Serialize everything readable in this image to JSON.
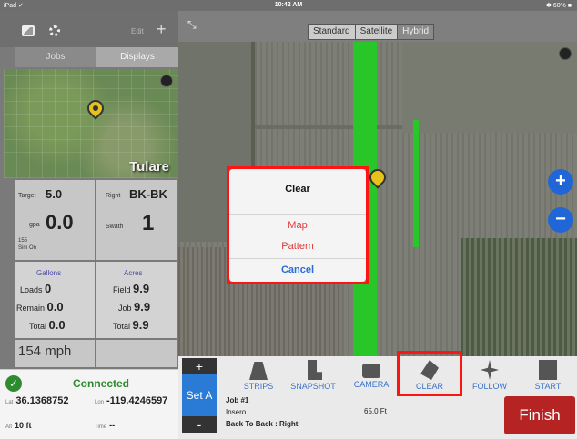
{
  "status_bar": {
    "left": "iPad ✓",
    "time": "10:42 AM",
    "right": "✱ 60% ■"
  },
  "left_panel": {
    "edit_label": "Edit",
    "add_label": "+",
    "tabs": [
      {
        "label": "Jobs",
        "selected": false
      },
      {
        "label": "Displays",
        "selected": true
      }
    ],
    "minimap_label": "Tulare",
    "tiles": {
      "target": {
        "label": "Target",
        "value": "5.0",
        "unit": "gpa",
        "big": "0.0",
        "sub1": "155",
        "sub2": "Sim On"
      },
      "right": {
        "label": "Right",
        "value": "BK-BK",
        "swath_label": "Swath",
        "swath_value": "1"
      },
      "gallons": {
        "title": "Gallons",
        "rows": [
          {
            "k": "Loads",
            "v": "0"
          },
          {
            "k": "Remain",
            "v": "0.0"
          },
          {
            "k": "Total",
            "v": "0.0"
          }
        ]
      },
      "acres": {
        "title": "Acres",
        "rows": [
          {
            "k": "Field",
            "v": "9.9"
          },
          {
            "k": "Job",
            "v": "9.9"
          },
          {
            "k": "Total",
            "v": "9.9"
          }
        ]
      },
      "speed": "154 mph"
    },
    "connection": {
      "status": "Connected",
      "lat_label": "Lat",
      "lat": "36.1368752",
      "lon_label": "Lon",
      "lon": "-119.4246597",
      "alt_label": "Alt",
      "alt": "10 ft",
      "time_label": "Time",
      "time": "--"
    }
  },
  "map": {
    "types": [
      {
        "label": "Standard",
        "selected": false
      },
      {
        "label": "Satellite",
        "selected": false
      },
      {
        "label": "Hybrid",
        "selected": true
      }
    ],
    "zoom_in": "+",
    "zoom_out": "−"
  },
  "dialog": {
    "title": "Clear",
    "options": [
      "Map",
      "Pattern"
    ],
    "cancel": "Cancel"
  },
  "toolbar": {
    "plus": "+",
    "set_a": "Set A",
    "minus": "-",
    "tools": [
      "STRIPS",
      "SNAPSHOT",
      "CAMERA",
      "CLEAR",
      "FOLLOW",
      "START"
    ],
    "job_name": "Job #1",
    "job_line2": "Insero",
    "job_line3": "Back To Back : Right",
    "distance": "65.0 Ft",
    "finish": "Finish"
  },
  "colors": {
    "accent_blue": "#2a6bd6",
    "finish_red": "#b52323",
    "connected_green": "#2e8b2e",
    "highlight_red": "#ff1414",
    "strip_green": "#28c628"
  }
}
